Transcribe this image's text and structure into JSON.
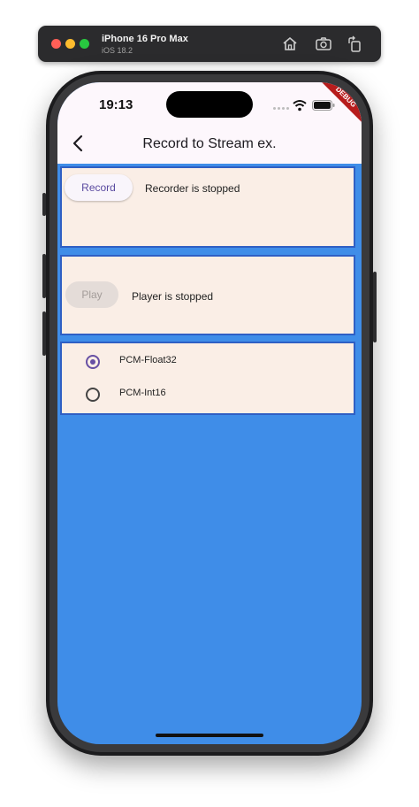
{
  "simulator": {
    "device_name": "iPhone 16 Pro Max",
    "os_version": "iOS 18.2",
    "toolbar_icons": [
      "home-icon",
      "screenshot-icon",
      "rotate-icon"
    ]
  },
  "status_bar": {
    "time": "19:13",
    "debug_banner": "DEBUG"
  },
  "app_bar": {
    "title": "Record to Stream ex.",
    "back_icon": "chevron-left-icon"
  },
  "recorder": {
    "button_label": "Record",
    "status": "Recorder is stopped"
  },
  "player": {
    "button_label": "Play",
    "button_enabled": false,
    "status": "Player is stopped"
  },
  "codec_options": [
    {
      "label": "PCM-Float32",
      "selected": true
    },
    {
      "label": "PCM-Int16",
      "selected": false
    }
  ],
  "colors": {
    "accent": "#6750a4",
    "background": "#3f8de8",
    "panel": "#faeee6",
    "panel_border": "#2f5fc4"
  }
}
